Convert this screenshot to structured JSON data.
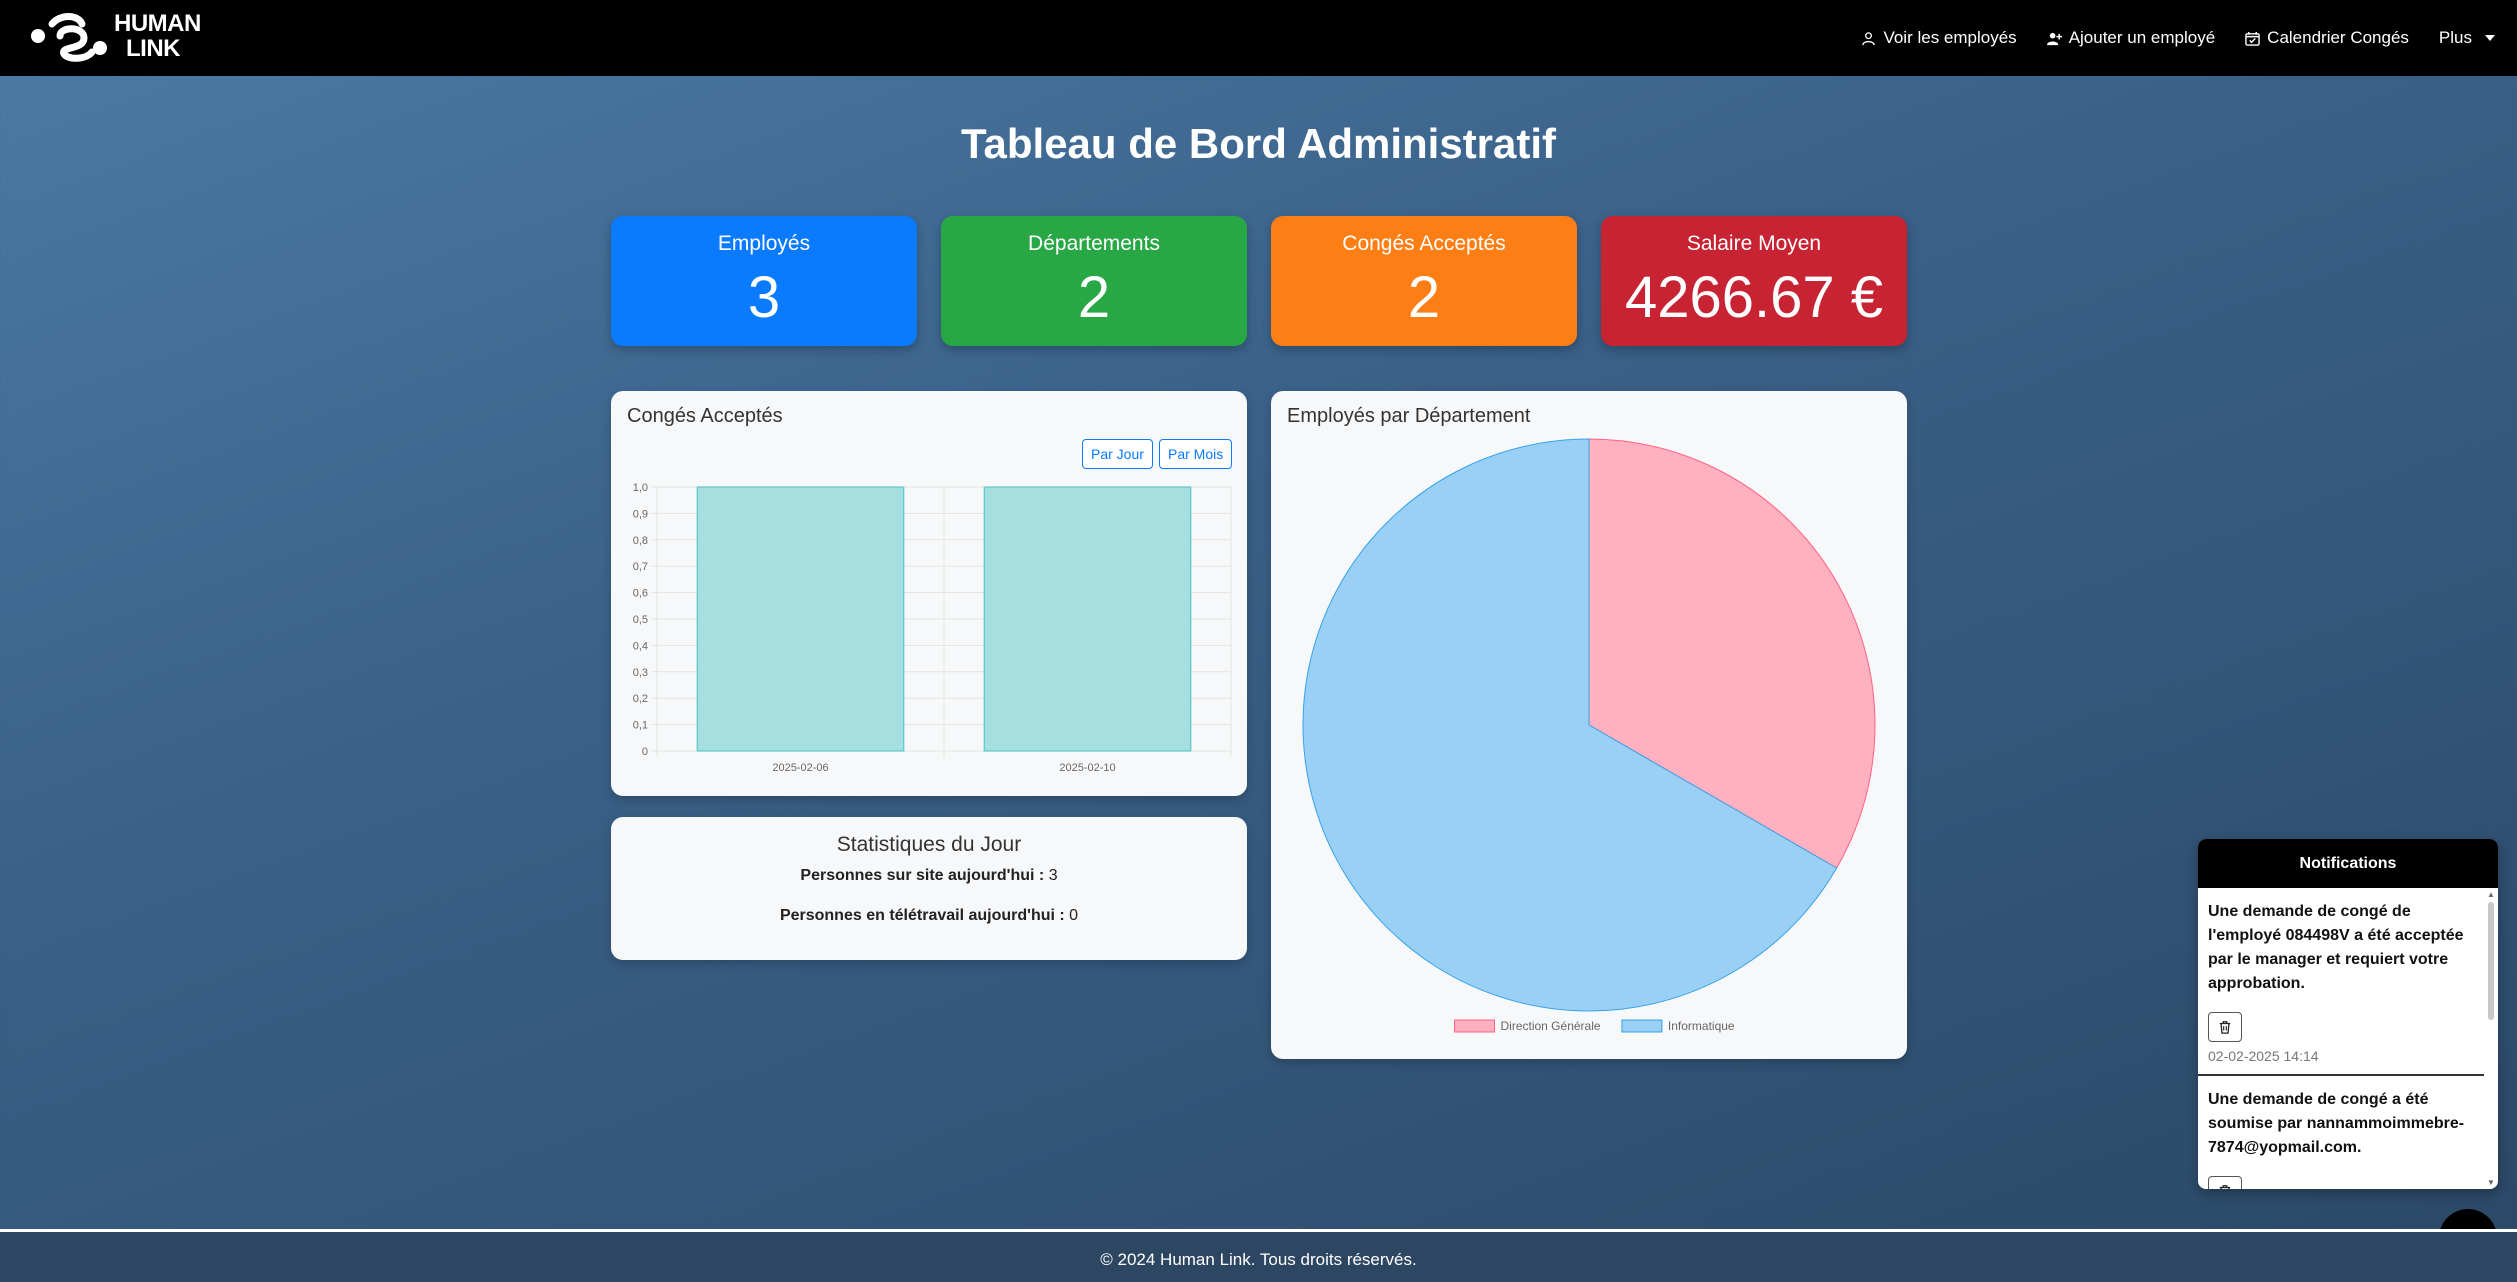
{
  "nav": {
    "logo_line1": "HUMAN",
    "logo_line2": "LINK",
    "links": [
      {
        "label": "Voir les employés",
        "icon": "person-icon"
      },
      {
        "label": "Ajouter un employé",
        "icon": "person-add-icon"
      },
      {
        "label": "Calendrier Congés",
        "icon": "calendar-check-icon"
      },
      {
        "label": "Plus",
        "icon": "chevron-down-icon"
      }
    ]
  },
  "title": "Tableau de Bord Administratif",
  "stats": [
    {
      "label": "Employés",
      "value": "3",
      "color": "#0a7bff"
    },
    {
      "label": "Départements",
      "value": "2",
      "color": "#28a745"
    },
    {
      "label": "Congés Acceptés",
      "value": "2",
      "color": "#fd7e14"
    },
    {
      "label": "Salaire Moyen",
      "value": "4266.67 €",
      "color": "#c82333"
    }
  ],
  "leave_panel": {
    "title": "Congés Acceptés",
    "btn_day": "Par Jour",
    "btn_month": "Par Mois"
  },
  "dept_panel": {
    "title": "Employés par Département"
  },
  "day_stats": {
    "title": "Statistiques du Jour",
    "onsite_label": "Personnes sur site aujourd'hui :",
    "onsite_value": "3",
    "remote_label": "Personnes en télétravail aujourd'hui :",
    "remote_value": "0"
  },
  "notifications": {
    "title": "Notifications",
    "items": [
      {
        "message": "Une demande de congé de l'employé 084498V a été acceptée par le manager et requiert votre approbation.",
        "time": "02-02-2025 14:14"
      },
      {
        "message": "Une demande de congé a été soumise par nannammoimmebre-7874@yopmail.com.",
        "time": ""
      }
    ]
  },
  "footer": "© 2024 Human Link. Tous droits réservés.",
  "chart_data": [
    {
      "type": "bar",
      "categories": [
        "2025-02-06",
        "2025-02-10"
      ],
      "values": [
        1,
        1
      ],
      "ylim": [
        0,
        1
      ],
      "yticks": [
        "0",
        "0,1",
        "0,2",
        "0,3",
        "0,4",
        "0,5",
        "0,6",
        "0,7",
        "0,8",
        "0,9",
        "1,0"
      ],
      "bar_color": "#a6dfdf",
      "grid": true
    },
    {
      "type": "pie",
      "labels": [
        "Direction Générale",
        "Informatique"
      ],
      "values": [
        1,
        2
      ],
      "colors": [
        "#ffb1c1",
        "#9ad0f5"
      ],
      "borders": [
        "#ff6384",
        "#36a2eb"
      ],
      "legend": "bottom"
    }
  ]
}
